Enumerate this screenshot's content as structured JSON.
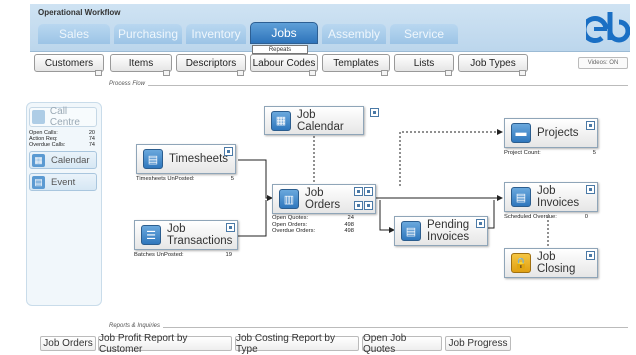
{
  "app": {
    "title": "Operational Workflow",
    "videos_label": "Videos: ON"
  },
  "main_tabs": [
    {
      "label": "Sales"
    },
    {
      "label": "Purchasing"
    },
    {
      "label": "Inventory"
    },
    {
      "label": "Jobs"
    },
    {
      "label": "Assembly"
    },
    {
      "label": "Service"
    }
  ],
  "active_sub_label": "Repeats",
  "sub_tabs": [
    {
      "label": "Customers"
    },
    {
      "label": "Items"
    },
    {
      "label": "Descriptors"
    },
    {
      "label": "Labour Codes"
    },
    {
      "label": "Templates"
    },
    {
      "label": "Lists"
    },
    {
      "label": "Job Types"
    }
  ],
  "sections": {
    "process_flow": "Process Flow",
    "reports": "Reports & Inquiries"
  },
  "side_panel": {
    "call_centre": "Call Centre",
    "stats": [
      {
        "label": "Open Calls:",
        "value": "20"
      },
      {
        "label": "Action Req:",
        "value": "74"
      },
      {
        "label": "Overdue Calls:",
        "value": "74"
      }
    ],
    "calendar": "Calendar",
    "event": "Event"
  },
  "nodes": {
    "timesheets": {
      "label": "Timesheets",
      "stat_label": "Timesheets UnPosted:",
      "stat_value": "5"
    },
    "job_transactions": {
      "label1": "Job",
      "label2": "Transactions",
      "stat_label": "Batches UnPosted:",
      "stat_value": "19"
    },
    "job_calendar": {
      "label": "Job Calendar"
    },
    "job_orders": {
      "label1": "Job",
      "label2": "Orders",
      "stats": [
        {
          "label": "Open Quotes:",
          "value": "24"
        },
        {
          "label": "Open Orders:",
          "value": "498"
        },
        {
          "label": "Overdue Orders:",
          "value": "498"
        }
      ]
    },
    "pending_invoices": {
      "label1": "Pending",
      "label2": "Invoices"
    },
    "projects": {
      "label": "Projects",
      "stat_label": "Project Count:",
      "stat_value": "5"
    },
    "job_invoices": {
      "label1": "Job",
      "label2": "Invoices",
      "stat_label": "Scheduled Overdue:",
      "stat_value": "0"
    },
    "job_closing": {
      "label1": "Job",
      "label2": "Closing"
    }
  },
  "reports": [
    {
      "label": "Job Orders"
    },
    {
      "label": "Job Profit Report by Customer"
    },
    {
      "label": "Job Costing Report by Type"
    },
    {
      "label": "Open Job Quotes"
    },
    {
      "label": "Job Progress"
    }
  ],
  "colors": {
    "accent": "#2e74bb",
    "logo_blue": "#1a6fc4",
    "header_bg": "#c6ddf1"
  }
}
